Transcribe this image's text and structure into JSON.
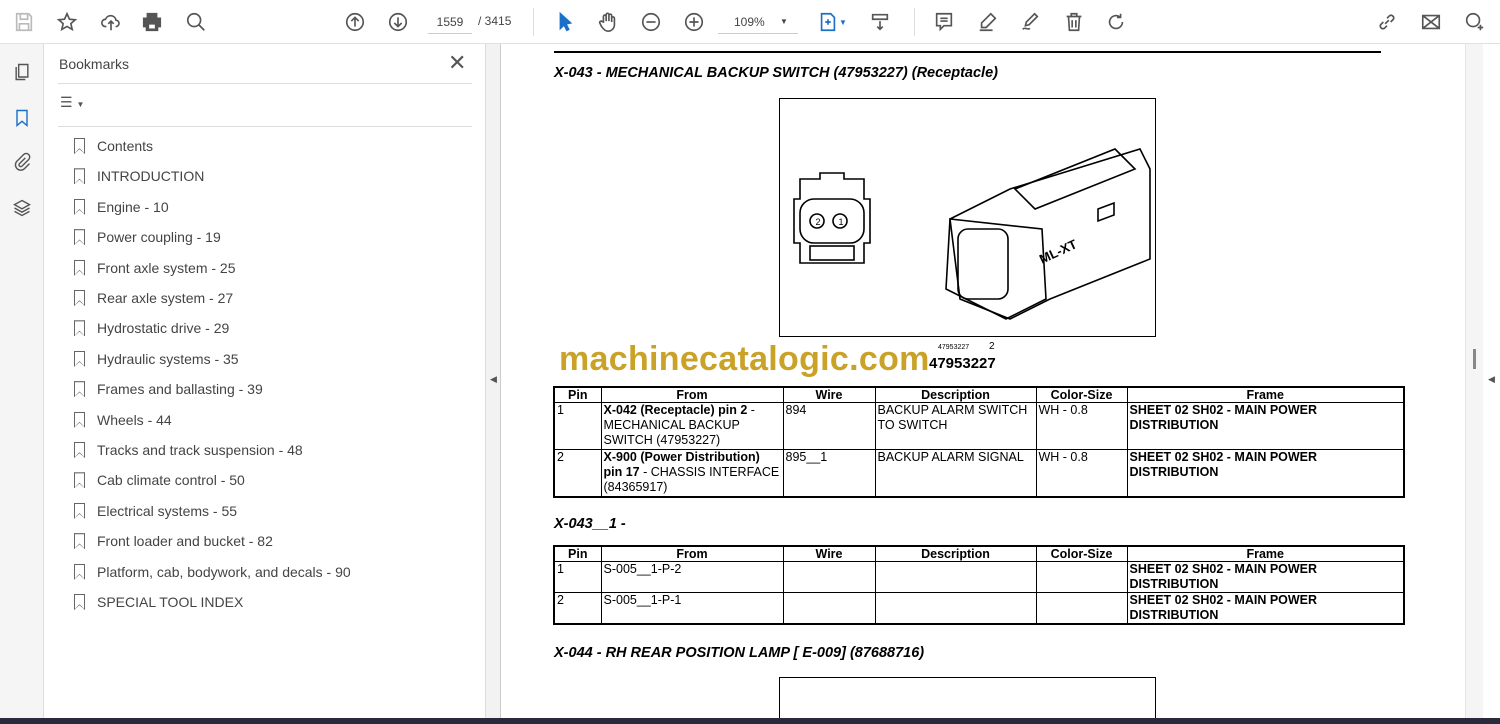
{
  "toolbar": {
    "page_current": "1559",
    "page_total": "/ 3415",
    "zoom": "109%"
  },
  "bookmarks": {
    "title": "Bookmarks",
    "items": [
      "Contents",
      "INTRODUCTION",
      "Engine - 10",
      "Power coupling - 19",
      "Front axle system - 25",
      "Rear axle system - 27",
      "Hydrostatic drive - 29",
      "Hydraulic systems - 35",
      "Frames and ballasting - 39",
      "Wheels - 44",
      "Tracks and track suspension - 48",
      "Cab climate control - 50",
      "Electrical systems - 55",
      "Front loader and bucket - 82",
      "Platform, cab, bodywork, and decals - 90",
      "SPECIAL TOOL INDEX"
    ]
  },
  "doc": {
    "heading1": "X-043 - MECHANICAL BACKUP SWITCH (47953227) (Receptacle)",
    "fig_caption_small": "47953227",
    "fig_caption_num": "2",
    "fig_caption_big": "47953227",
    "connector_label": "ML-XT",
    "watermark": "machinecatalogic.com",
    "columns": [
      "Pin",
      "From",
      "Wire",
      "Description",
      "Color-Size",
      "Frame"
    ],
    "table1": [
      {
        "pin": "1",
        "from_bold": "X-042 (Receptacle) pin 2",
        "from_rest": " - MECHANICAL BACKUP SWITCH (47953227)",
        "wire": "894",
        "desc": "BACKUP ALARM SWITCH TO SWITCH",
        "color": "WH - 0.8",
        "frame": "SHEET 02 SH02 - MAIN POWER DISTRIBUTION"
      },
      {
        "pin": "2",
        "from_bold": "X-900 (Power Distribution) pin 17",
        "from_rest": " - CHASSIS INTERFACE (84365917)",
        "wire": "895__1",
        "desc": "BACKUP ALARM SIGNAL",
        "color": "WH - 0.8",
        "frame": "SHEET 02 SH02 - MAIN POWER DISTRIBUTION"
      }
    ],
    "heading2": "X-043__1 -",
    "table2": [
      {
        "pin": "1",
        "from": "S-005__1-P-2",
        "wire": "",
        "desc": "",
        "color": "",
        "frame": "SHEET 02 SH02 - MAIN POWER DISTRIBUTION"
      },
      {
        "pin": "2",
        "from": "S-005__1-P-1",
        "wire": "",
        "desc": "",
        "color": "",
        "frame": "SHEET 02 SH02 - MAIN POWER DISTRIBUTION"
      }
    ],
    "heading3": "X-044 - RH REAR POSITION LAMP [ E-009] (87688716)"
  }
}
